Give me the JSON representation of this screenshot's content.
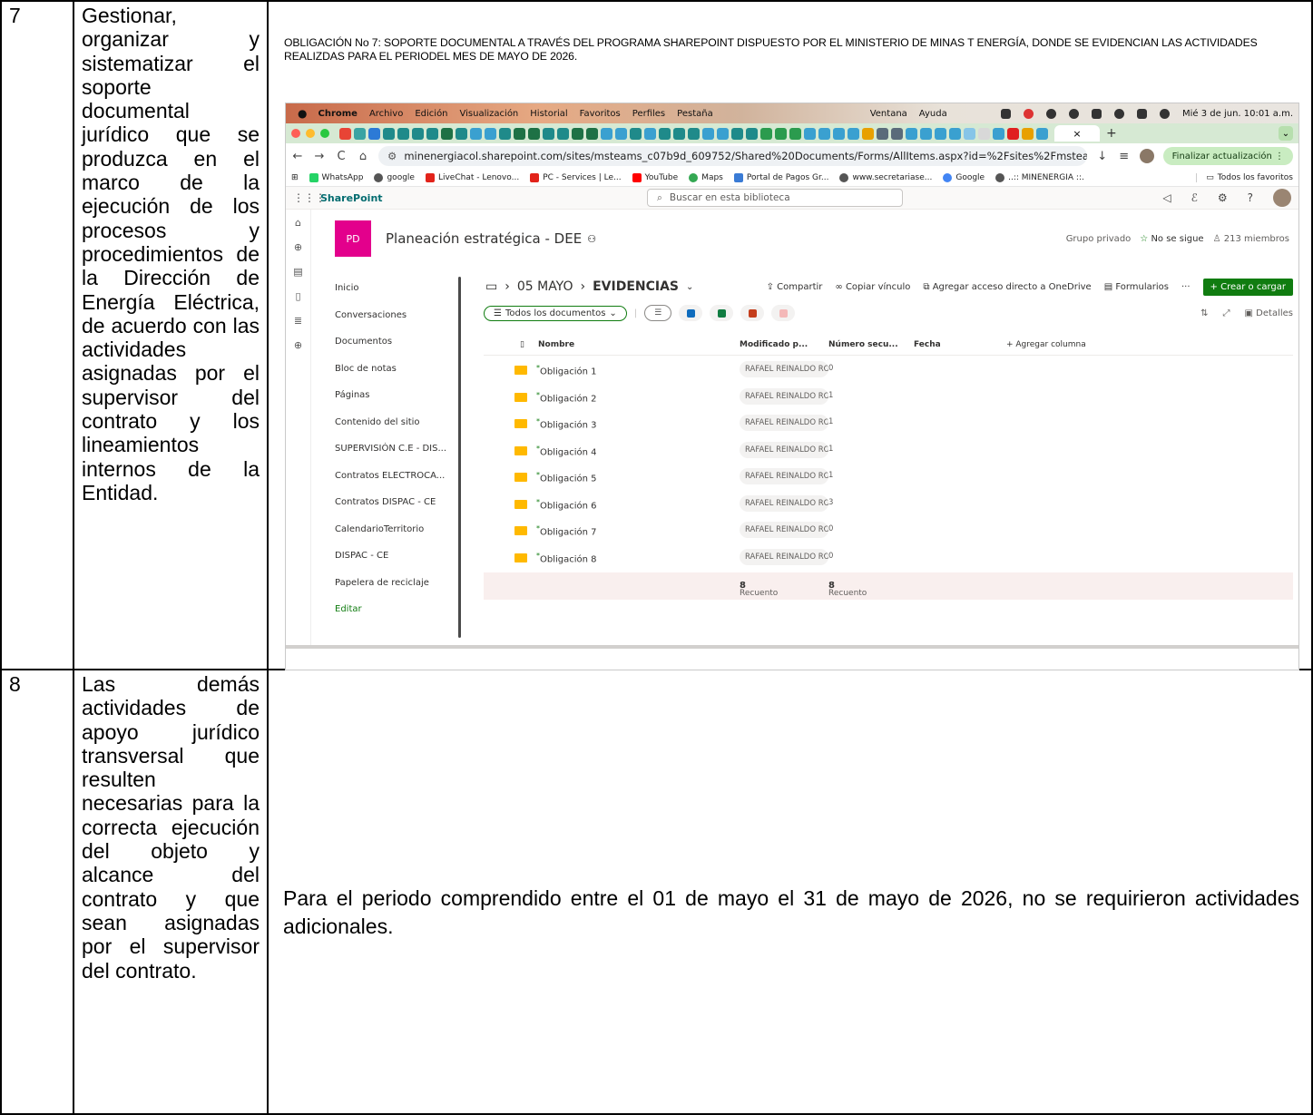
{
  "row7": {
    "number": "7",
    "description": "Gestionar, organizar y sistematizar el soporte documental jurídico que se produzca en el marco de la ejecución de los procesos y procedimientos de la Dirección de Energía Eléctrica, de acuerdo con las actividades asignadas por el supervisor del contrato y los lineamientos internos de la Entidad.",
    "caption": "OBLIGACIÓN No 7: SOPORTE DOCUMENTAL A TRAVÉS DEL PROGRAMA SHAREPOINT DISPUESTO POR EL MINISTERIO DE MINAS T ENERGÍA, DONDE SE EVIDENCIAN LAS ACTIVIDADES REALIZDAS PARA EL PERIODEL MES DE MAYO DE 2026."
  },
  "row8": {
    "number": "8",
    "description": "Las demás actividades de apoyo jurídico transversal que resulten necesarias para la correcta ejecución del objeto y alcance del contrato y que sean asignadas por el supervisor del contrato.",
    "content": "Para el periodo comprendido entre el 01 de mayo el 31 de mayo de 2026, no se requirieron actividades adicionales."
  },
  "screenshot": {
    "menubar": {
      "apple": "",
      "items": [
        "Chrome",
        "Archivo",
        "Edición",
        "Visualización",
        "Historial",
        "Favoritos",
        "Perfiles",
        "Pestaña"
      ],
      "right_items": [
        "Ventana",
        "Ayuda"
      ],
      "clock": "Mié 3 de jun.  10:01 a.m."
    },
    "browser": {
      "active_tab_close": "×",
      "new_tab": "+",
      "url": "minenergiacol.sharepoint.com/sites/msteams_c07b9d_609752/Shared%20Documents/Forms/AllItems.aspx?id=%2Fsites%2Fmsteams_c07b9d_...",
      "update_button": "Finalizar actualización  ⋮",
      "bookmarks": [
        "WhatsApp",
        "google",
        "LiveChat - Lenovo...",
        "PC - Services | Le...",
        "YouTube",
        "Maps",
        "Portal de Pagos Gr...",
        "www.secretariase...",
        "Google",
        "..:: MINENERGIA ::."
      ],
      "all_bookmarks": "Todos los favoritos"
    },
    "sharepoint": {
      "brand": "SharePoint",
      "search_placeholder": "Buscar en esta biblioteca",
      "site_logo": "PD",
      "site_title": "Planeación estratégica - DEE",
      "group_type": "Grupo privado",
      "follow": "No se sigue",
      "members": "213 miembros",
      "nav": [
        "Inicio",
        "Conversaciones",
        "Documentos",
        "Bloc de notas",
        "Páginas",
        "Contenido del sitio",
        "SUPERVISIÓN C.E - DIS...",
        "Contratos ELECTROCA...",
        "Contratos DISPAC - CE",
        "CalendarioTerritorio",
        "DISPAC - CE",
        "Papelera de reciclaje",
        "Editar"
      ],
      "breadcrumb_parent": "05 MAYO",
      "breadcrumb_current": "EVIDENCIAS",
      "commands": [
        "Compartir",
        "Copiar vínculo",
        "Agregar acceso directo a OneDrive",
        "Formularios",
        "···"
      ],
      "create_button": "+  Crear o cargar",
      "view_name": "Todos los documentos",
      "details": "Detalles",
      "columns": [
        "Nombre",
        "Modificado p...",
        "Número secu...",
        "Fecha",
        "+  Agregar columna"
      ],
      "items": [
        {
          "name": "Obligación 1",
          "author": "RAFAEL REINALDO RO",
          "count": "0"
        },
        {
          "name": "Obligación 2",
          "author": "RAFAEL REINALDO RO",
          "count": "1"
        },
        {
          "name": "Obligación 3",
          "author": "RAFAEL REINALDO RO",
          "count": "1"
        },
        {
          "name": "Obligación 4",
          "author": "RAFAEL REINALDO RO",
          "count": "1"
        },
        {
          "name": "Obligación 5",
          "author": "RAFAEL REINALDO RO",
          "count": "1"
        },
        {
          "name": "Obligación 6",
          "author": "RAFAEL REINALDO RO",
          "count": "3"
        },
        {
          "name": "Obligación 7",
          "author": "RAFAEL REINALDO RO",
          "count": "0"
        },
        {
          "name": "Obligación 8",
          "author": "RAFAEL REINALDO RO",
          "count": "0"
        }
      ],
      "count_label": "Recuento",
      "count_value": "8"
    }
  }
}
